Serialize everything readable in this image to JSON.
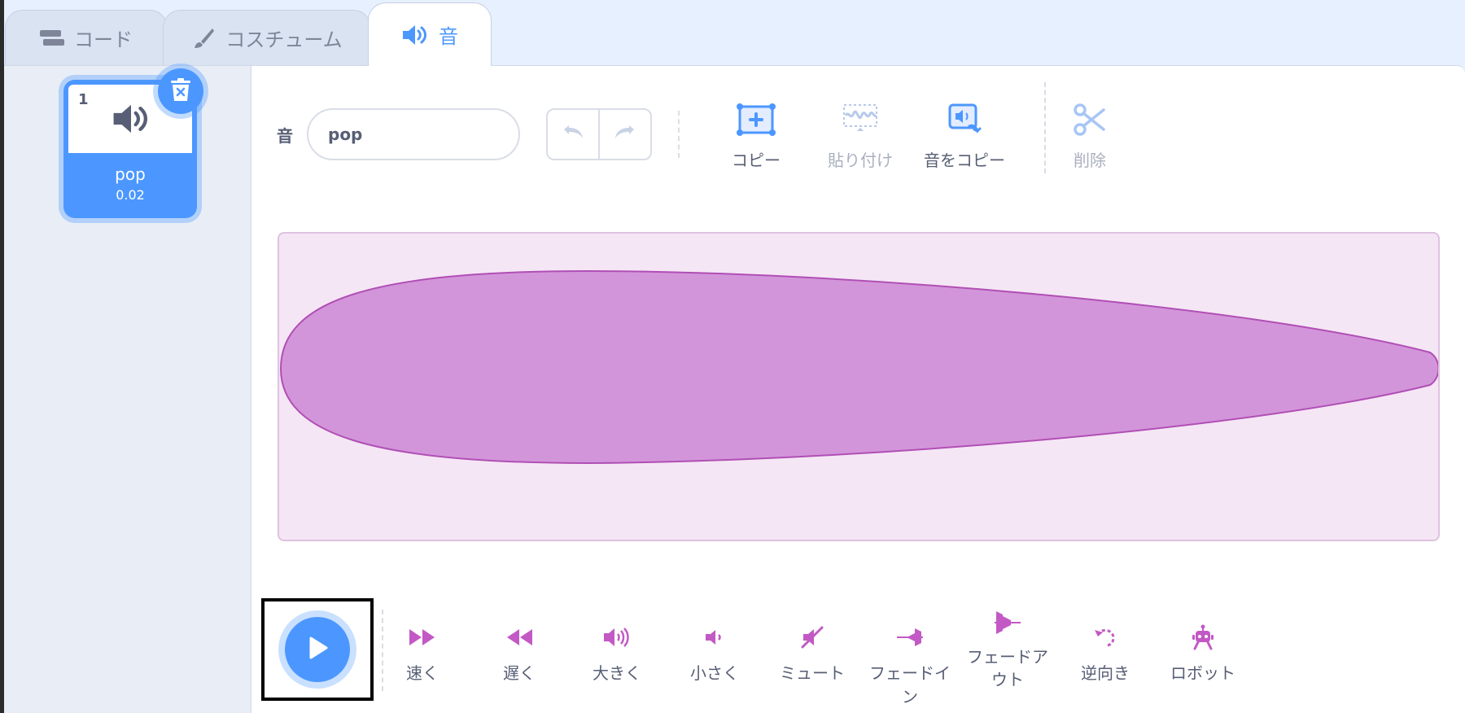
{
  "tabs": [
    {
      "label": "コード",
      "icon": "code-icon"
    },
    {
      "label": "コスチューム",
      "icon": "brush-icon"
    },
    {
      "label": "音",
      "icon": "speaker-icon",
      "active": true
    }
  ],
  "sound_list": [
    {
      "index": "1",
      "name": "pop",
      "duration": "0.02"
    }
  ],
  "editor": {
    "name_label": "音",
    "name_value": "pop",
    "tools": [
      {
        "label": "コピー",
        "icon": "copy-icon",
        "enabled": true
      },
      {
        "label": "貼り付け",
        "icon": "paste-icon",
        "enabled": false
      },
      {
        "label": "音をコピー",
        "icon": "copy-to-new-icon",
        "enabled": true
      },
      {
        "label": "削除",
        "icon": "scissors-icon",
        "enabled": false
      }
    ]
  },
  "effects": [
    {
      "label": "速く",
      "icon": "faster-icon"
    },
    {
      "label": "遅く",
      "icon": "slower-icon"
    },
    {
      "label": "大きく",
      "icon": "louder-icon"
    },
    {
      "label": "小さく",
      "icon": "softer-icon"
    },
    {
      "label": "ミュート",
      "icon": "mute-icon"
    },
    {
      "label": "フェードイン",
      "icon": "fade-in-icon"
    },
    {
      "label": "フェードアウト",
      "icon": "fade-out-icon"
    },
    {
      "label": "逆向き",
      "icon": "reverse-icon"
    },
    {
      "label": "ロボット",
      "icon": "robot-icon"
    }
  ],
  "colors": {
    "accent": "#4c97ff",
    "effect": "#c259c5",
    "waveform_fill": "#d395da",
    "waveform_bg": "#f5e6f5"
  }
}
